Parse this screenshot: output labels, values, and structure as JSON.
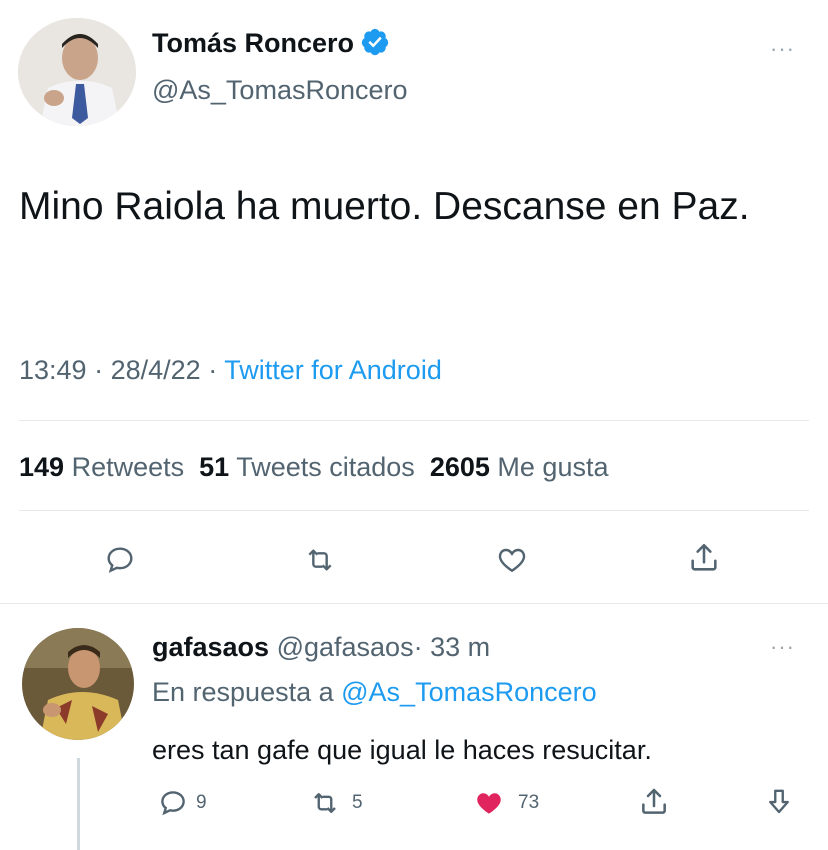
{
  "tweet": {
    "author_name": "Tomás Roncero",
    "author_handle": "@As_TomasRoncero",
    "more_label": "···",
    "text": "Mino Raiola ha muerto. Descanse en Paz.",
    "time": "13:49",
    "date": "28/4/22",
    "source": "Twitter for Android",
    "sep": "·",
    "stats": {
      "retweets_count": "149",
      "retweets_label": "Retweets",
      "quotes_count": "51",
      "quotes_label": "Tweets citados",
      "likes_count": "2605",
      "likes_label": "Me gusta"
    },
    "actions": [
      "reply-icon",
      "retweet-icon",
      "like-icon",
      "share-icon"
    ]
  },
  "reply": {
    "author_name": "gafasaos",
    "author_handle": "@gafasaos",
    "sep": "·",
    "time_ago": "33 m",
    "more_label": "···",
    "in_reply_to_label": "En respuesta a",
    "in_reply_to_handle": "@As_TomasRoncero",
    "text": "eres tan gafe que igual le haces resucitar.",
    "counts": {
      "replies": "9",
      "retweets": "5",
      "likes": "73"
    },
    "actions": [
      "reply-icon",
      "retweet-icon",
      "liked-heart-icon",
      "share-icon",
      "download-icon"
    ]
  },
  "colors": {
    "accent": "#1d9bf0",
    "like": "#f91880",
    "secondary_text": "#536471"
  }
}
